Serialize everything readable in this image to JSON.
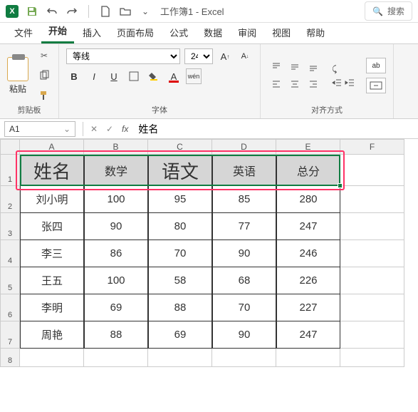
{
  "app": {
    "title": "工作簿1 - Excel",
    "icon_letter": "X"
  },
  "search": {
    "icon": "🔍",
    "placeholder": "搜索"
  },
  "tabs": [
    "文件",
    "开始",
    "插入",
    "页面布局",
    "公式",
    "数据",
    "审阅",
    "视图",
    "帮助"
  ],
  "active_tab": "开始",
  "ribbon": {
    "clipboard": {
      "label": "剪贴板",
      "paste": "粘贴"
    },
    "font": {
      "label": "字体",
      "name": "等线",
      "size": "24",
      "wen": "wén"
    },
    "align": {
      "label": "对齐方式",
      "ab": "ab"
    }
  },
  "name_box": "A1",
  "formula_value": "姓名",
  "columns": [
    "A",
    "B",
    "C",
    "D",
    "E",
    "F"
  ],
  "chart_data": {
    "type": "table",
    "headers": [
      "姓名",
      "数学",
      "语文",
      "英语",
      "总分"
    ],
    "rows": [
      {
        "name": "刘小明",
        "math": 100,
        "chinese": 95,
        "english": 85,
        "total": 280
      },
      {
        "name": "张四",
        "math": 90,
        "chinese": 80,
        "english": 77,
        "total": 247
      },
      {
        "name": "李三",
        "math": 86,
        "chinese": 70,
        "english": 90,
        "total": 246
      },
      {
        "name": "王五",
        "math": 100,
        "chinese": 58,
        "english": 68,
        "total": 226
      },
      {
        "name": "李明",
        "math": 69,
        "chinese": 88,
        "english": 70,
        "total": 227
      },
      {
        "name": "周艳",
        "math": 88,
        "chinese": 69,
        "english": 90,
        "total": 247
      }
    ]
  },
  "row_numbers": [
    "1",
    "2",
    "3",
    "4",
    "5",
    "6",
    "7",
    "8"
  ]
}
